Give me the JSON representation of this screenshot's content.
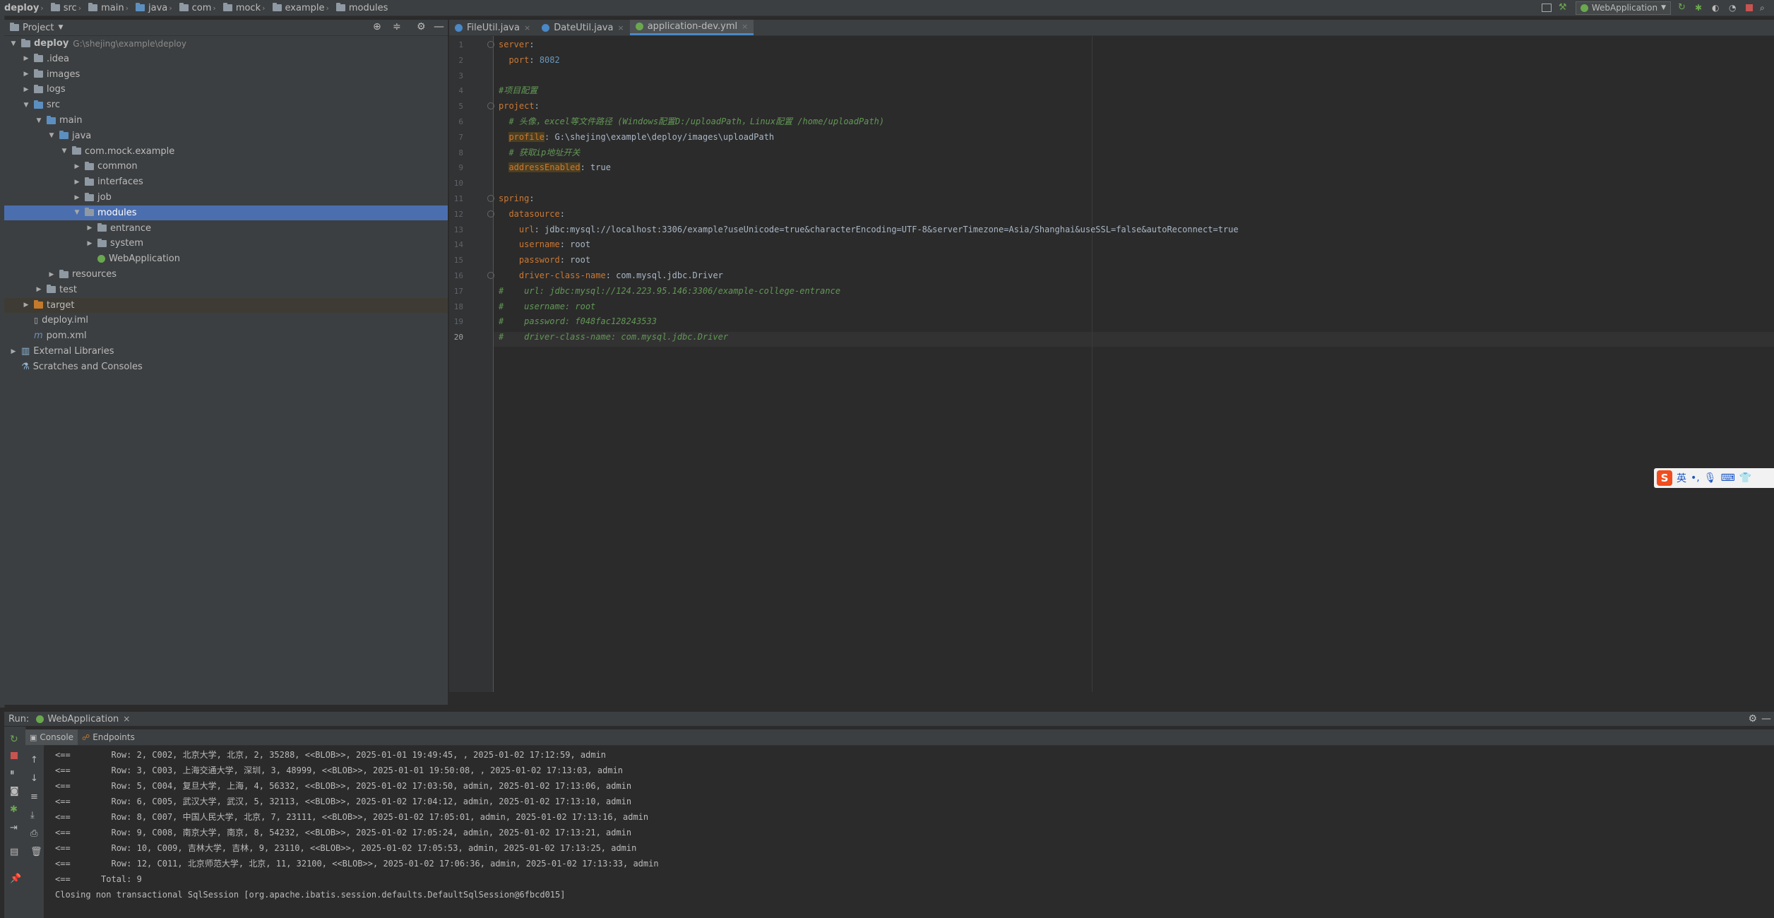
{
  "breadcrumb": [
    "deploy",
    "src",
    "main",
    "java",
    "com",
    "mock",
    "example",
    "modules"
  ],
  "toolbar": {
    "run_config": "WebApplication"
  },
  "project_panel": {
    "title": "Project",
    "tree": [
      {
        "label": "deploy",
        "hint": "G:\\shejing\\example\\deploy",
        "depth": 0,
        "arrow": "▼",
        "bold": true
      },
      {
        "label": ".idea",
        "depth": 1,
        "arrow": "▶"
      },
      {
        "label": "images",
        "depth": 1,
        "arrow": "▶"
      },
      {
        "label": "logs",
        "depth": 1,
        "arrow": "▶"
      },
      {
        "label": "src",
        "depth": 1,
        "arrow": "▼"
      },
      {
        "label": "main",
        "depth": 2,
        "arrow": "▼"
      },
      {
        "label": "java",
        "depth": 3,
        "arrow": "▼"
      },
      {
        "label": "com.mock.example",
        "depth": 4,
        "arrow": "▼"
      },
      {
        "label": "common",
        "depth": 5,
        "arrow": "▶"
      },
      {
        "label": "interfaces",
        "depth": 5,
        "arrow": "▶"
      },
      {
        "label": "job",
        "depth": 5,
        "arrow": "▶"
      },
      {
        "label": "modules",
        "depth": 5,
        "arrow": "▼",
        "selected": true
      },
      {
        "label": "entrance",
        "depth": 6,
        "arrow": "▶"
      },
      {
        "label": "system",
        "depth": 6,
        "arrow": "▶"
      },
      {
        "label": "WebApplication",
        "depth": 6,
        "arrow": ""
      },
      {
        "label": "resources",
        "depth": 3,
        "arrow": "▶"
      },
      {
        "label": "test",
        "depth": 2,
        "arrow": "▶"
      },
      {
        "label": "target",
        "depth": 1,
        "arrow": "▶",
        "target": true
      },
      {
        "label": "deploy.iml",
        "depth": 1,
        "arrow": ""
      },
      {
        "label": "pom.xml",
        "depth": 1,
        "arrow": ""
      },
      {
        "label": "External Libraries",
        "depth": 0,
        "arrow": "▶"
      },
      {
        "label": "Scratches and Consoles",
        "depth": 0,
        "arrow": ""
      }
    ]
  },
  "editor": {
    "tabs": [
      {
        "label": "FileUtil.java",
        "active": false
      },
      {
        "label": "DateUtil.java",
        "active": false
      },
      {
        "label": "application-dev.yml",
        "active": true
      }
    ],
    "lines": [
      {
        "n": "1",
        "html": "<span class='k'>server</span>:"
      },
      {
        "n": "2",
        "html": "  <span class='k'>port</span>: <span class='n'>8082</span>"
      },
      {
        "n": "3",
        "html": ""
      },
      {
        "n": "4",
        "html": "<span class='c'>#项目配置</span>"
      },
      {
        "n": "5",
        "html": "<span class='k'>project</span>:"
      },
      {
        "n": "6",
        "html": "  <span class='c'># 头像，excel等文件路径 (Windows配置D:/uploadPath，Linux配置 /home/uploadPath)</span>"
      },
      {
        "n": "7",
        "html": "  <span class='k hl'>profile</span>: G:\\shejing\\example\\deploy/images\\uploadPath"
      },
      {
        "n": "8",
        "html": "  <span class='c'># 获取ip地址开关</span>"
      },
      {
        "n": "9",
        "html": "  <span class='k hl'>addressEnabled</span>: true"
      },
      {
        "n": "10",
        "html": ""
      },
      {
        "n": "11",
        "html": "<span class='k'>spring</span>:"
      },
      {
        "n": "12",
        "html": "  <span class='k'>datasource</span>:"
      },
      {
        "n": "13",
        "html": "    <span class='k'>url</span>: jdbc:mysql://localhost:3306/example?useUnicode=true&amp;characterEncoding=UTF-8&amp;serverTimezone=Asia/Shanghai&amp;useSSL=false&amp;autoReconnect=true"
      },
      {
        "n": "14",
        "html": "    <span class='k'>username</span>: root"
      },
      {
        "n": "15",
        "html": "    <span class='k'>password</span>: root"
      },
      {
        "n": "16",
        "html": "    <span class='k'>driver-class-name</span>: com.mysql.jdbc.Driver"
      },
      {
        "n": "17",
        "html": "<span class='c'>#    url: jdbc:mysql://124.223.95.146:3306/example-college-entrance</span>"
      },
      {
        "n": "18",
        "html": "<span class='c'>#    username: root</span>"
      },
      {
        "n": "19",
        "html": "<span class='c'>#    password: f048fac128243533</span>"
      },
      {
        "n": "20",
        "html": "<span class='c'>#    driver-class-name: com.mysql.jdbc.Driver</span>"
      }
    ]
  },
  "run_panel": {
    "label": "Run:",
    "config_tab": "WebApplication",
    "tabs": [
      "Console",
      "Endpoints"
    ],
    "console_lines": [
      "<==        Row: 2, C002, 北京大学, 北京, 2, 35288, <<BLOB>>, 2025-01-01 19:49:45, , 2025-01-02 17:12:59, admin",
      "<==        Row: 3, C003, 上海交通大学, 深圳, 3, 48999, <<BLOB>>, 2025-01-01 19:50:08, , 2025-01-02 17:13:03, admin",
      "<==        Row: 5, C004, 复旦大学, 上海, 4, 56332, <<BLOB>>, 2025-01-02 17:03:50, admin, 2025-01-02 17:13:06, admin",
      "<==        Row: 6, C005, 武汉大学, 武汉, 5, 32113, <<BLOB>>, 2025-01-02 17:04:12, admin, 2025-01-02 17:13:10, admin",
      "<==        Row: 8, C007, 中国人民大学, 北京, 7, 23111, <<BLOB>>, 2025-01-02 17:05:01, admin, 2025-01-02 17:13:16, admin",
      "<==        Row: 9, C008, 南京大学, 南京, 8, 54232, <<BLOB>>, 2025-01-02 17:05:24, admin, 2025-01-02 17:13:21, admin",
      "<==        Row: 10, C009, 吉林大学, 吉林, 9, 23110, <<BLOB>>, 2025-01-02 17:05:53, admin, 2025-01-02 17:13:25, admin",
      "<==        Row: 12, C011, 北京师范大学, 北京, 11, 32100, <<BLOB>>, 2025-01-02 17:06:36, admin, 2025-01-02 17:13:33, admin",
      "<==      Total: 9",
      "Closing non transactional SqlSession [org.apache.ibatis.session.defaults.DefaultSqlSession@6fbcd015]"
    ]
  },
  "ime": {
    "lang": "英",
    "punct": "•,"
  }
}
